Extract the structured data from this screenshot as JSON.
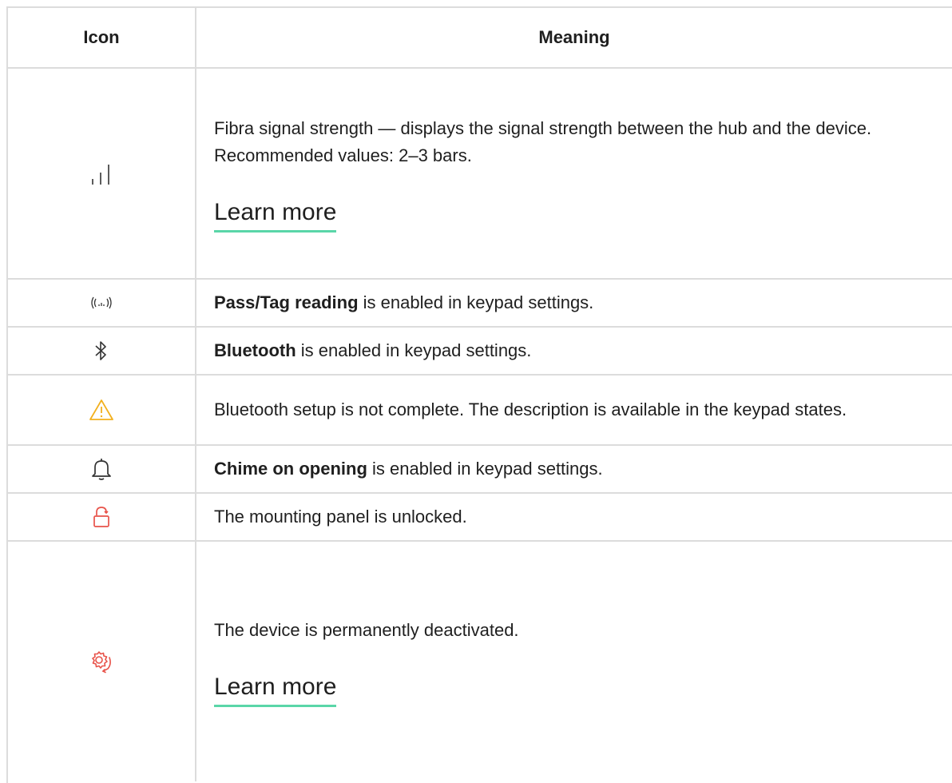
{
  "table": {
    "header": {
      "icon": "Icon",
      "meaning": "Meaning"
    },
    "rows": [
      {
        "icon": "signal-bars-icon",
        "text": "Fibra signal strength — displays the signal strength between the hub and the device. Recommended values: 2–3 bars.",
        "link": "Learn more"
      },
      {
        "icon": "nfc-reader-icon",
        "bold": "Pass/Tag reading",
        "text": " is enabled in keypad settings."
      },
      {
        "icon": "bluetooth-icon",
        "bold": "Bluetooth",
        "text": " is enabled in keypad settings."
      },
      {
        "icon": "warning-icon",
        "text": "Bluetooth setup is not complete. The description is available in the keypad states."
      },
      {
        "icon": "bell-icon",
        "bold": "Chime on opening",
        "text": " is enabled in keypad settings."
      },
      {
        "icon": "unlocked-icon",
        "text": "The mounting panel is unlocked."
      },
      {
        "icon": "gear-deactivated-icon",
        "text": "The device is permanently deactivated.",
        "link": "Learn more"
      }
    ]
  },
  "colors": {
    "border": "#dcdcdc",
    "link_underline": "#5ad6a8",
    "warning": "#f2b01e",
    "alert_red": "#e8534a"
  }
}
